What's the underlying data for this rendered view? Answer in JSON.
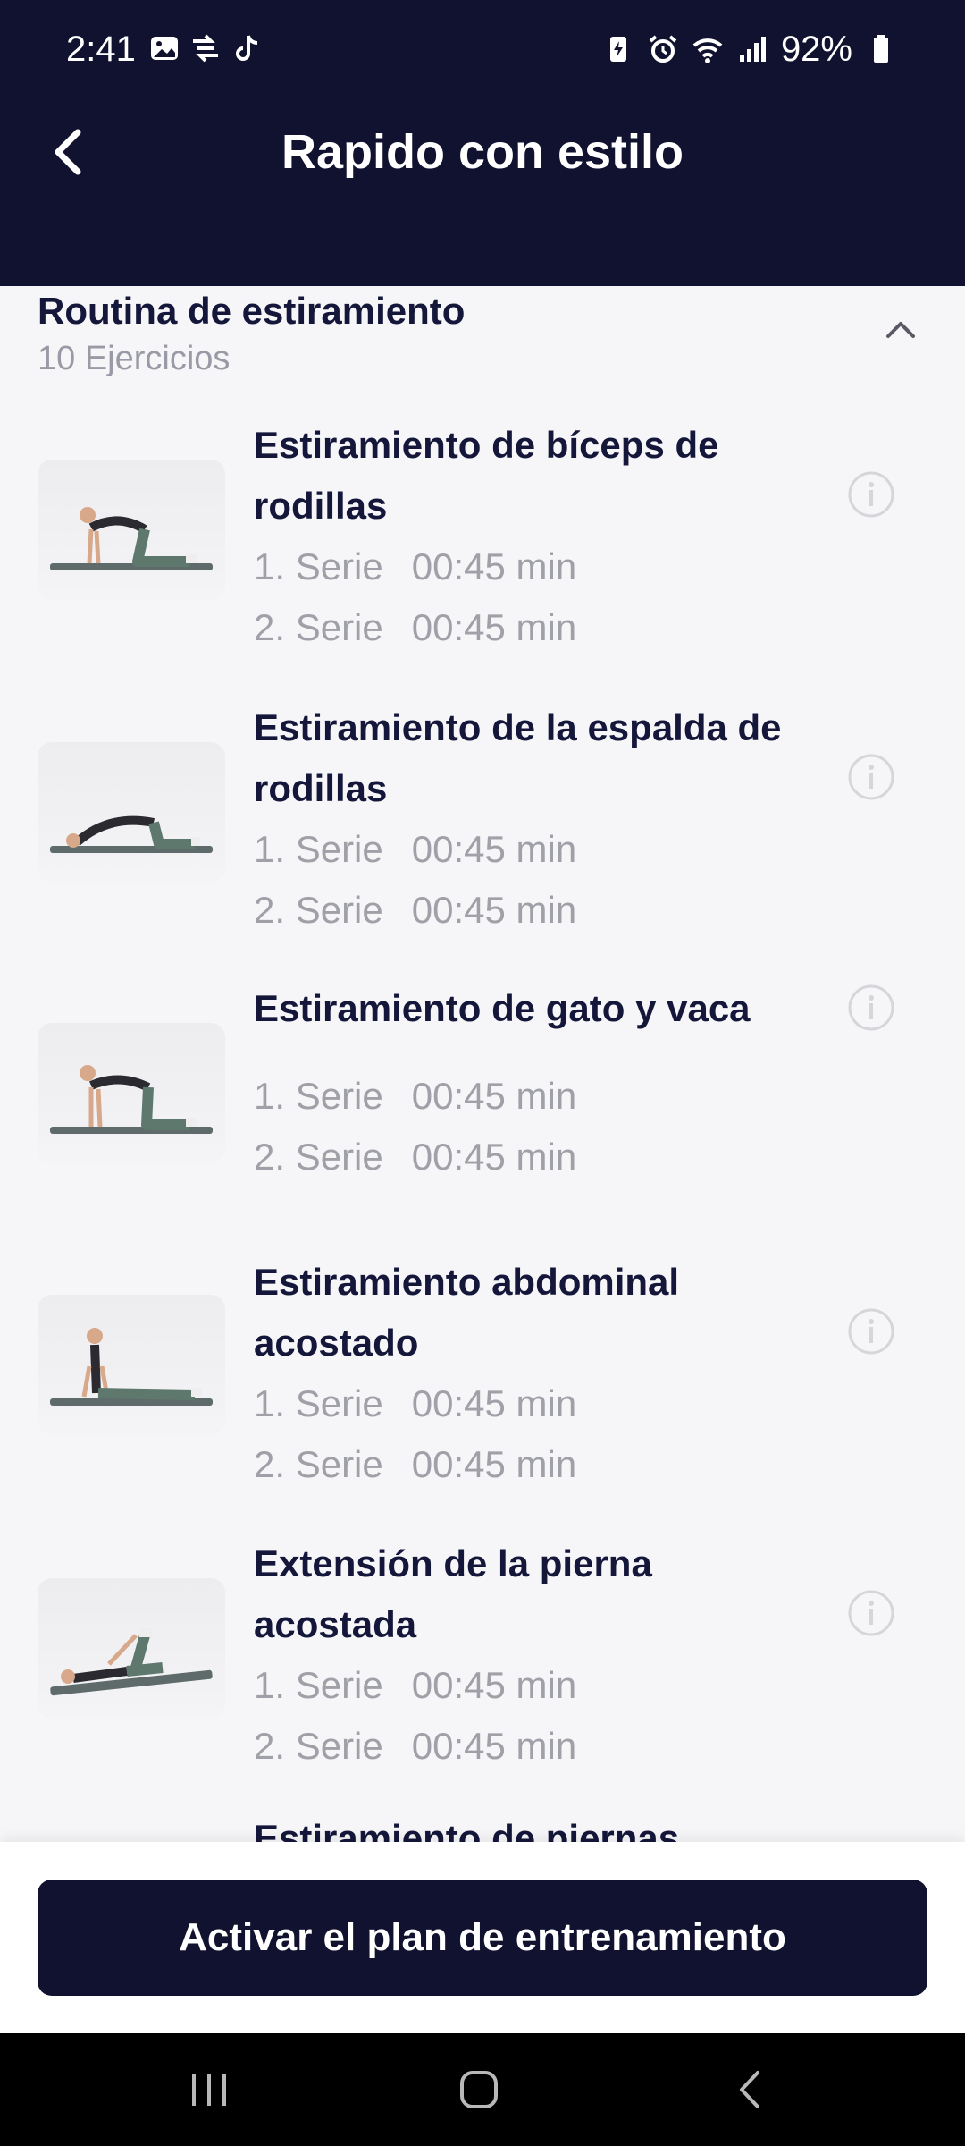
{
  "status_bar": {
    "time": "2:41",
    "battery_percent": "92%",
    "left_icons": [
      "gallery-icon",
      "transfer-icon",
      "tiktok-icon"
    ],
    "right_icons": [
      "battery-saver-icon",
      "alarm-icon",
      "wifi-icon",
      "signal-icon",
      "battery-icon"
    ]
  },
  "header": {
    "title": "Rapido con estilo",
    "back_icon": "chevron-left-icon",
    "background": "#11122f"
  },
  "section": {
    "title": "Routina de estiramiento",
    "count": "10 Ejercicios",
    "collapse_icon": "chevron-up-icon"
  },
  "exercises": [
    {
      "name_lines": [
        "Estiramiento de bíceps de",
        "rodillas"
      ],
      "series": [
        {
          "label": "1. Serie",
          "time": "00:45 min"
        },
        {
          "label": "2. Serie",
          "time": "00:45 min"
        }
      ]
    },
    {
      "name_lines": [
        "Estiramiento de la espalda de",
        "rodillas"
      ],
      "series": [
        {
          "label": "1. Serie",
          "time": "00:45 min"
        },
        {
          "label": "2. Serie",
          "time": "00:45 min"
        }
      ]
    },
    {
      "name_lines": [
        "Estiramiento de gato y vaca"
      ],
      "series": [
        {
          "label": "1. Serie",
          "time": "00:45 min"
        },
        {
          "label": "2. Serie",
          "time": "00:45 min"
        }
      ]
    },
    {
      "name_lines": [
        "Estiramiento abdominal",
        "acostado"
      ],
      "series": [
        {
          "label": "1. Serie",
          "time": "00:45 min"
        },
        {
          "label": "2. Serie",
          "time": "00:45 min"
        }
      ]
    },
    {
      "name_lines": [
        "Extensión de la pierna",
        "acostada"
      ],
      "series": [
        {
          "label": "1. Serie",
          "time": "00:45 min"
        },
        {
          "label": "2. Serie",
          "time": "00:45 min"
        }
      ]
    },
    {
      "name_lines": [
        "Estiramiento de piernas"
      ],
      "series": []
    }
  ],
  "footer": {
    "cta_label": "Activar el plan de entrenamiento",
    "cta_color": "#11122f"
  },
  "nav_bar": {
    "buttons": [
      "recent-apps-icon",
      "home-icon",
      "back-icon"
    ]
  }
}
